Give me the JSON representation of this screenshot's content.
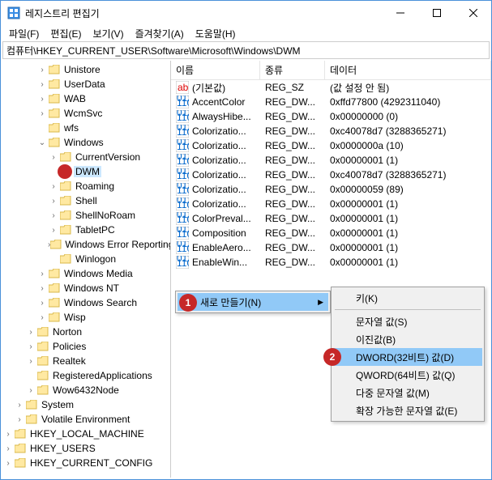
{
  "window": {
    "title": "레지스트리 편집기"
  },
  "menubar": {
    "file": "파일(F)",
    "edit": "편집(E)",
    "view": "보기(V)",
    "favorites": "즐겨찾기(A)",
    "help": "도움말(H)"
  },
  "addressbar": {
    "path": "컴퓨터\\HKEY_CURRENT_USER\\Software\\Microsoft\\Windows\\DWM"
  },
  "tree": {
    "items": [
      {
        "label": "Unistore",
        "depth": 3,
        "expander": ">"
      },
      {
        "label": "UserData",
        "depth": 3,
        "expander": ">"
      },
      {
        "label": "WAB",
        "depth": 3,
        "expander": ">"
      },
      {
        "label": "WcmSvc",
        "depth": 3,
        "expander": ">"
      },
      {
        "label": "wfs",
        "depth": 3,
        "expander": ""
      },
      {
        "label": "Windows",
        "depth": 3,
        "expander": "v"
      },
      {
        "label": "CurrentVersion",
        "depth": 4,
        "expander": ">"
      },
      {
        "label": "DWM",
        "depth": 4,
        "expander": "",
        "selected": true,
        "redDot": true
      },
      {
        "label": "Roaming",
        "depth": 4,
        "expander": ">"
      },
      {
        "label": "Shell",
        "depth": 4,
        "expander": ">"
      },
      {
        "label": "ShellNoRoam",
        "depth": 4,
        "expander": ">"
      },
      {
        "label": "TabletPC",
        "depth": 4,
        "expander": ">"
      },
      {
        "label": "Windows Error Reporting",
        "depth": 4,
        "expander": ">"
      },
      {
        "label": "Winlogon",
        "depth": 4,
        "expander": ""
      },
      {
        "label": "Windows Media",
        "depth": 3,
        "expander": ">"
      },
      {
        "label": "Windows NT",
        "depth": 3,
        "expander": ">"
      },
      {
        "label": "Windows Search",
        "depth": 3,
        "expander": ">"
      },
      {
        "label": "Wisp",
        "depth": 3,
        "expander": ">"
      },
      {
        "label": "Norton",
        "depth": 2,
        "expander": ">"
      },
      {
        "label": "Policies",
        "depth": 2,
        "expander": ">"
      },
      {
        "label": "Realtek",
        "depth": 2,
        "expander": ">"
      },
      {
        "label": "RegisteredApplications",
        "depth": 2,
        "expander": ""
      },
      {
        "label": "Wow6432Node",
        "depth": 2,
        "expander": ">"
      },
      {
        "label": "System",
        "depth": 1,
        "expander": ">"
      },
      {
        "label": "Volatile Environment",
        "depth": 1,
        "expander": ">"
      },
      {
        "label": "HKEY_LOCAL_MACHINE",
        "depth": 0,
        "expander": ">",
        "noFolder": false
      },
      {
        "label": "HKEY_USERS",
        "depth": 0,
        "expander": ">"
      },
      {
        "label": "HKEY_CURRENT_CONFIG",
        "depth": 0,
        "expander": ">"
      }
    ]
  },
  "list": {
    "headers": {
      "name": "이름",
      "type": "종류",
      "data": "데이터"
    },
    "rows": [
      {
        "name": "(기본값)",
        "type": "REG_SZ",
        "data": "(값 설정 안 됨)",
        "icon": "ab"
      },
      {
        "name": "AccentColor",
        "type": "REG_DW...",
        "data": "0xffd77800 (4292311040)",
        "icon": "bin"
      },
      {
        "name": "AlwaysHibe...",
        "type": "REG_DW...",
        "data": "0x00000000 (0)",
        "icon": "bin"
      },
      {
        "name": "Colorizatio...",
        "type": "REG_DW...",
        "data": "0xc40078d7 (3288365271)",
        "icon": "bin"
      },
      {
        "name": "Colorizatio...",
        "type": "REG_DW...",
        "data": "0x0000000a (10)",
        "icon": "bin"
      },
      {
        "name": "Colorizatio...",
        "type": "REG_DW...",
        "data": "0x00000001 (1)",
        "icon": "bin"
      },
      {
        "name": "Colorizatio...",
        "type": "REG_DW...",
        "data": "0xc40078d7 (3288365271)",
        "icon": "bin"
      },
      {
        "name": "Colorizatio...",
        "type": "REG_DW...",
        "data": "0x00000059 (89)",
        "icon": "bin"
      },
      {
        "name": "Colorizatio...",
        "type": "REG_DW...",
        "data": "0x00000001 (1)",
        "icon": "bin"
      },
      {
        "name": "ColorPreval...",
        "type": "REG_DW...",
        "data": "0x00000001 (1)",
        "icon": "bin"
      },
      {
        "name": "Composition",
        "type": "REG_DW...",
        "data": "0x00000001 (1)",
        "icon": "bin"
      },
      {
        "name": "EnableAero...",
        "type": "REG_DW...",
        "data": "0x00000001 (1)",
        "icon": "bin"
      },
      {
        "name": "EnableWin...",
        "type": "REG_DW...",
        "data": "0x00000001 (1)",
        "icon": "bin"
      }
    ]
  },
  "context_menu_1": {
    "new_label": "새로 만들기(N)"
  },
  "context_menu_2": {
    "key": "키(K)",
    "string": "문자열 값(S)",
    "binary": "이진값(B)",
    "dword": "DWORD(32비트) 값(D)",
    "qword": "QWORD(64비트) 값(Q)",
    "multi": "다중 문자열 값(M)",
    "expand": "확장 가능한 문자열 값(E)"
  },
  "badges": {
    "one": "1",
    "two": "2"
  }
}
